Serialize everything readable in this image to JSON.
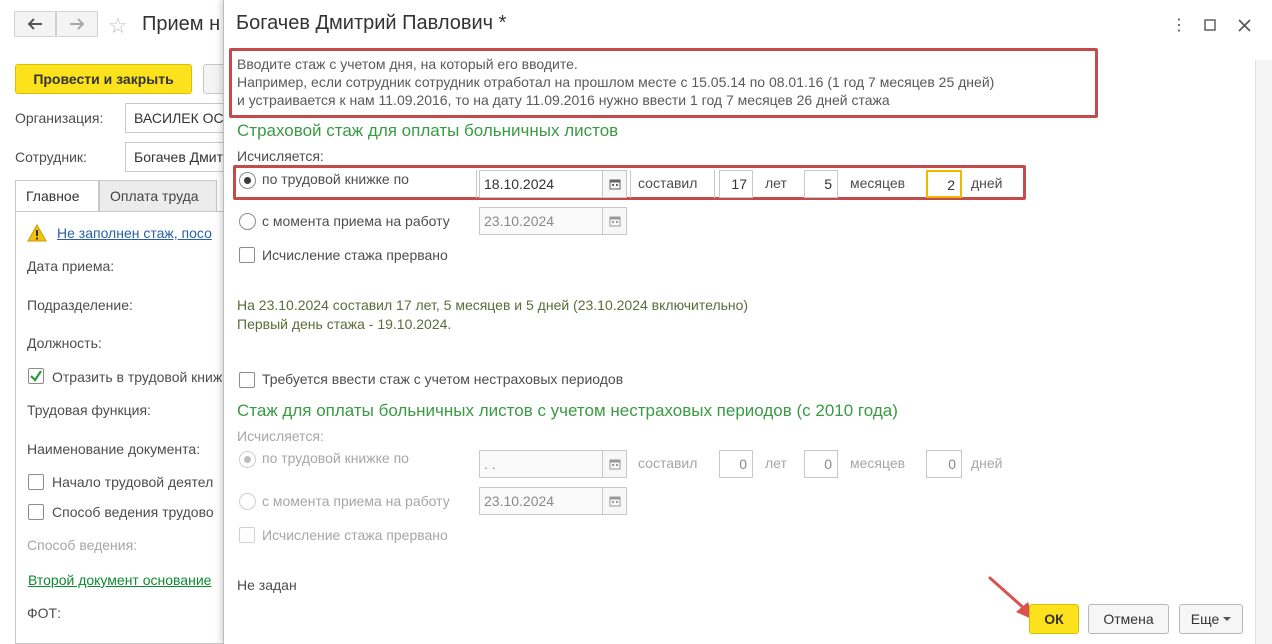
{
  "background_form": {
    "title": "Прием н",
    "post_and_close": "Провести и закрыть",
    "org_label": "Организация:",
    "org_value": "ВАСИЛЕК ОС",
    "employee_label": "Сотрудник:",
    "employee_value": "Богачев Дмит",
    "tabs": [
      "Главное",
      "Оплата труда"
    ],
    "warning_link": "Не заполнен стаж, посо",
    "fields": [
      "Дата приема:",
      "Подразделение:",
      "Должность:"
    ],
    "reflect_label": "Отразить в трудовой книж",
    "labor_function": "Трудовая функция:",
    "doc_name": "Наименование документа:",
    "start_labor": "Начало трудовой деятел",
    "labor_book_way": "Способ ведения трудово",
    "way_label": "Способ ведения:",
    "second_doc_link": "Второй документ основание",
    "fot_label": "ФОТ:"
  },
  "dialog": {
    "title": "Богачев Дмитрий Павлович *",
    "note_lines": [
      "Вводите стаж с учетом дня, на который его вводите.",
      "Например, если сотрудник сотрудник отработал на прошлом месте с 15.05.14 по 08.01.16 (1 год 7 месяцев 25 дней)",
      "и устраивается к нам 11.09.2016, то на дату 11.09.2016 нужно ввести 1 год 7 месяцев 26 дней стажа"
    ],
    "section1": {
      "title": "Страховой стаж для оплаты больничных листов",
      "calc_label": "Исчисляется:",
      "by_book_label": "по трудовой книжке по",
      "by_book_date": "18.10.2024",
      "made_label": "составил",
      "years": "17",
      "years_label": "лет",
      "months": "5",
      "months_label": "месяцев",
      "days": "2",
      "days_label": "дней",
      "from_hire_label": "с момента приема на работу",
      "from_hire_date": "23.10.2024",
      "interrupted_label": "Исчисление стажа прервано",
      "info_line1": "На 23.10.2024 составил 17 лет, 5 месяцев и 5 дней (23.10.2024 включительно)",
      "info_line2": "Первый день стажа - 19.10.2024."
    },
    "nonins_checkbox_label": "Требуется ввести стаж с учетом нестраховых периодов",
    "section2": {
      "title": "Стаж для оплаты больничных листов с учетом нестраховых периодов (с 2010 года)",
      "calc_label": "Исчисляется:",
      "by_book_label": "по трудовой книжке по",
      "by_book_date": " .  .",
      "made_label": "составил",
      "years": "0",
      "years_label": "лет",
      "months": "0",
      "months_label": "месяцев",
      "days": "0",
      "days_label": "дней",
      "from_hire_label": "с момента приема на работу",
      "from_hire_date": "23.10.2024",
      "interrupted_label": "Исчисление стажа прервано",
      "not_set": "Не задан"
    },
    "buttons": {
      "ok": "ОК",
      "cancel": "Отмена",
      "more": "Еще"
    }
  },
  "colors": {
    "accent_yellow": "#fbe21d",
    "section_green": "#3a9a43",
    "highlight_red": "#c44b4b",
    "arrow_red": "#d9534f"
  }
}
